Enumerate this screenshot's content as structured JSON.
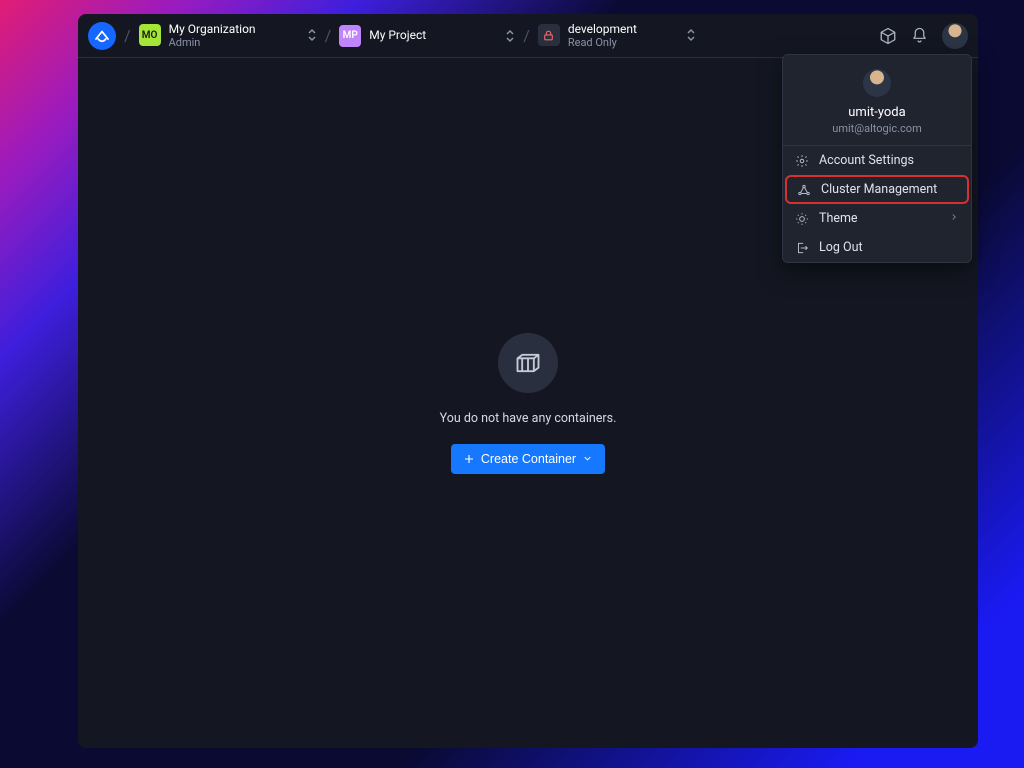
{
  "org": {
    "badge": "MO",
    "name": "My Organization",
    "role": "Admin"
  },
  "project": {
    "badge": "MP",
    "name": "My Project"
  },
  "environment": {
    "name": "development",
    "mode": "Read Only"
  },
  "main": {
    "empty_message": "You do not have any containers.",
    "create_button_label": "Create Container"
  },
  "user_menu": {
    "username": "umit-yoda",
    "email": "umit@altogic.com",
    "items": {
      "account_settings": "Account Settings",
      "cluster_management": "Cluster Management",
      "theme": "Theme",
      "log_out": "Log Out"
    }
  }
}
